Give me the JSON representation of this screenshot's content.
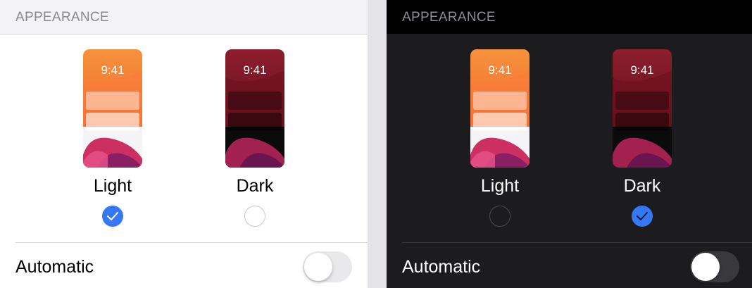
{
  "colors": {
    "accent": "#3478f6",
    "light_bg": "#ffffff",
    "dark_bg": "#1c1c1e"
  },
  "light_panel": {
    "header": "APPEARANCE",
    "options": [
      {
        "time": "9:41",
        "label": "Light",
        "selected": true
      },
      {
        "time": "9:41",
        "label": "Dark",
        "selected": false
      }
    ],
    "automatic": {
      "label": "Automatic",
      "on": false
    }
  },
  "dark_panel": {
    "header": "APPEARANCE",
    "options": [
      {
        "time": "9:41",
        "label": "Light",
        "selected": false
      },
      {
        "time": "9:41",
        "label": "Dark",
        "selected": true
      }
    ],
    "automatic": {
      "label": "Automatic",
      "on": false
    }
  }
}
